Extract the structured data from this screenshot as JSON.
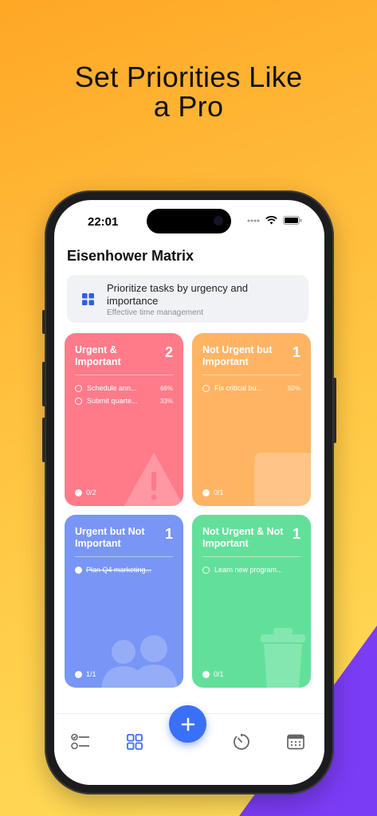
{
  "headline": [
    "Set Priorities Like",
    "a Pro"
  ],
  "status_bar": {
    "time": "22:01",
    "icons": [
      "cellular-dots-icon",
      "wifi-icon",
      "battery-icon"
    ]
  },
  "app": {
    "title": "Eisenhower Matrix",
    "banner": {
      "icon": "grid-icon",
      "main": "Prioritize tasks by urgency and importance",
      "sub": "Effective time management"
    },
    "quadrants": [
      {
        "title": "Urgent & Important",
        "count": "2",
        "color": "#ff7b8a",
        "tasks": [
          {
            "name": "Schedule ann...",
            "progress": "66%",
            "done": false
          },
          {
            "name": "Submit quarte...",
            "progress": "33%",
            "done": false
          }
        ],
        "footer": "0/2",
        "deco_icon": "warning-triangle-icon"
      },
      {
        "title": "Not Urgent but Important",
        "count": "1",
        "color": "#ffb464",
        "tasks": [
          {
            "name": "Fix critical bu...",
            "progress": "50%",
            "done": false
          }
        ],
        "footer": "0/1",
        "deco_icon": "calendar-icon"
      },
      {
        "title": "Urgent but Not Important",
        "count": "1",
        "color": "#7896f5",
        "tasks": [
          {
            "name": "Plan Q4 marketing...",
            "progress": "",
            "done": true
          }
        ],
        "footer": "1/1",
        "deco_icon": "people-icon"
      },
      {
        "title": "Not Urgent & Not Important",
        "count": "1",
        "color": "#62e09a",
        "tasks": [
          {
            "name": "Learn new program...",
            "progress": "",
            "done": false
          }
        ],
        "footer": "0/1",
        "deco_icon": "trash-icon"
      }
    ],
    "tabbar": [
      {
        "name": "tasks-list-icon"
      },
      {
        "name": "matrix-grid-icon",
        "active": true
      },
      {
        "name": "add-icon"
      },
      {
        "name": "timer-icon"
      },
      {
        "name": "calendar-icon"
      }
    ],
    "accent_color": "#3a6ff7"
  }
}
